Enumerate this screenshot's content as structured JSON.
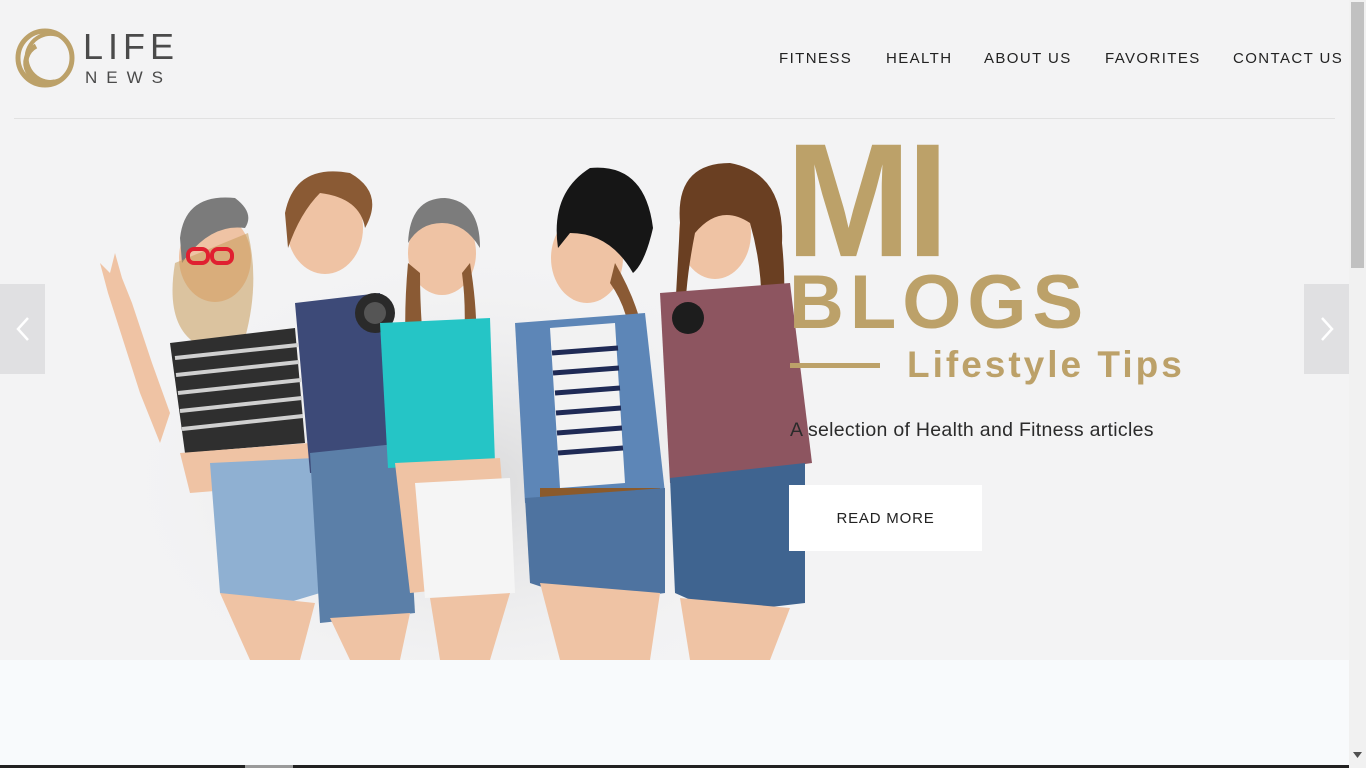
{
  "header": {
    "logo": {
      "line1": "LIFE",
      "line2": "NEWS"
    },
    "nav": [
      {
        "label": "FITNESS"
      },
      {
        "label": "HEALTH"
      },
      {
        "label": "ABOUT US"
      },
      {
        "label": "FAVORITES"
      },
      {
        "label": "CONTACT US"
      }
    ]
  },
  "hero": {
    "title_line1": "MI",
    "title_line2": "BLOGS",
    "subtitle": "Lifestyle Tips",
    "description": "A selection of Health and Fitness articles",
    "button_label": "READ MORE",
    "image_icon": "group-of-five-friends-photo",
    "prev_icon": "chevron-left-icon",
    "next_icon": "chevron-right-icon"
  },
  "colors": {
    "accent_gold": "#bca169",
    "background": "#f3f3f4",
    "nav_text": "#222222"
  }
}
